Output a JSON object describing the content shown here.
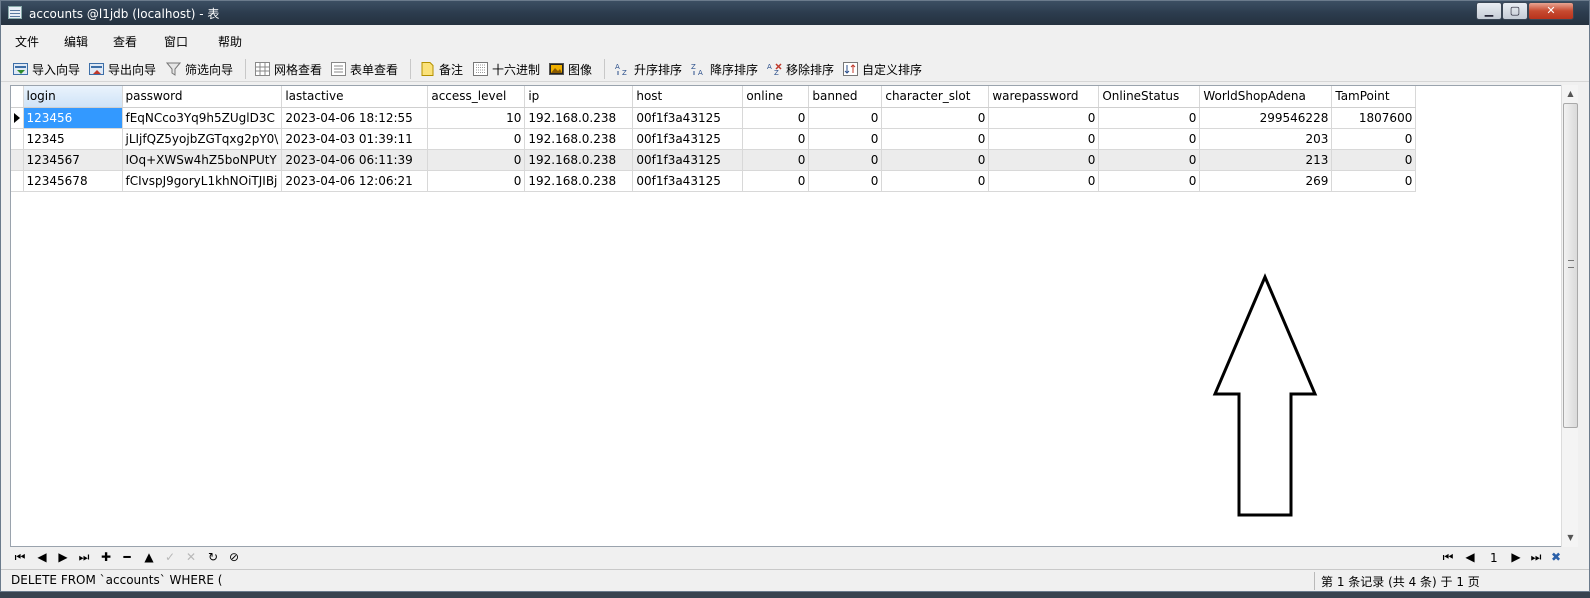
{
  "window": {
    "title": "accounts @l1jdb (localhost) - 表"
  },
  "menu": [
    "文件",
    "编辑",
    "查看",
    "窗口",
    "帮助"
  ],
  "toolbar": {
    "import": "导入向导",
    "export": "导出向导",
    "filter": "筛选向导",
    "grid_view": "网格查看",
    "form_view": "表单查看",
    "memo": "备注",
    "hex": "十六进制",
    "image": "图像",
    "sort_asc": "升序排序",
    "sort_desc": "降序排序",
    "remove_sort": "移除排序",
    "custom_sort": "自定义排序"
  },
  "table": {
    "columns": [
      "login",
      "password",
      "lastactive",
      "access_level",
      "ip",
      "host",
      "online",
      "banned",
      "character_slot",
      "warepassword",
      "OnlineStatus",
      "WorldShopAdena",
      "TamPoint"
    ],
    "rows": [
      [
        "123456",
        "fEqNCco3Yq9h5ZUglD3C",
        "2023-04-06 18:12:55",
        "10",
        "192.168.0.238",
        "00f1f3a43125",
        "0",
        "0",
        "0",
        "0",
        "0",
        "299546228",
        "1807600"
      ],
      [
        "12345",
        "jLIjfQZ5yojbZGTqxg2pY0\\",
        "2023-04-03 01:39:11",
        "0",
        "192.168.0.238",
        "00f1f3a43125",
        "0",
        "0",
        "0",
        "0",
        "0",
        "203",
        "0"
      ],
      [
        "1234567",
        "IOq+XWSw4hZ5boNPUtY",
        "2023-04-06 06:11:39",
        "0",
        "192.168.0.238",
        "00f1f3a43125",
        "0",
        "0",
        "0",
        "0",
        "0",
        "213",
        "0"
      ],
      [
        "12345678",
        "fCIvspJ9goryL1khNOiTJIBj",
        "2023-04-06 12:06:21",
        "0",
        "192.168.0.238",
        "00f1f3a43125",
        "0",
        "0",
        "0",
        "0",
        "0",
        "269",
        "0"
      ]
    ],
    "selected_row": 0
  },
  "navigator": {
    "page": "1"
  },
  "status": {
    "sql": "DELETE FROM `accounts` WHERE (",
    "record_info": "第 1 条记录 (共 4 条) 于 1 页"
  }
}
